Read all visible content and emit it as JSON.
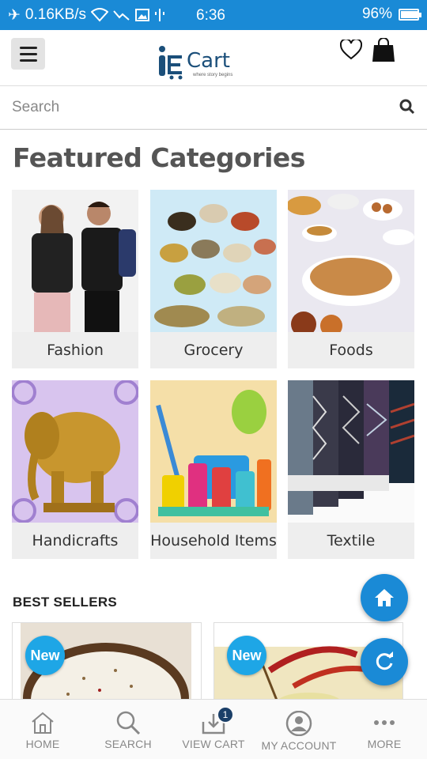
{
  "status_bar": {
    "net_speed": "0.16KB/s",
    "time": "6:36",
    "battery": "96%",
    "battery_level": 0.96
  },
  "header": {
    "logo_text": "Cart",
    "logo_tagline": "where story begins"
  },
  "search": {
    "placeholder": "Search"
  },
  "featured": {
    "title": "Featured Categories",
    "categories": [
      {
        "label": "Fashion"
      },
      {
        "label": "Grocery"
      },
      {
        "label": "Foods"
      },
      {
        "label": "Handicrafts"
      },
      {
        "label": "Household Items"
      },
      {
        "label": "Textile"
      }
    ]
  },
  "best_sellers": {
    "title": "BEST SELLERS",
    "products": [
      {
        "badge": "New"
      },
      {
        "badge": "New"
      }
    ]
  },
  "bottom_nav": {
    "items": [
      {
        "label": "HOME",
        "icon": "home-icon"
      },
      {
        "label": "SEARCH",
        "icon": "search-icon"
      },
      {
        "label": "VIEW CART",
        "icon": "cart-download-icon",
        "badge": "1"
      },
      {
        "label": "MY ACCOUNT",
        "icon": "account-icon"
      },
      {
        "label": "MORE",
        "icon": "more-icon"
      }
    ]
  },
  "colors": {
    "status_bar": "#1a8ad6",
    "accent": "#1ea6e6",
    "brand": "#1b4f7a"
  }
}
